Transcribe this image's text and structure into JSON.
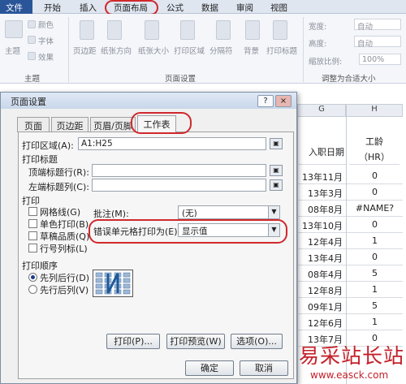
{
  "ribbon": {
    "tabs": [
      "文件",
      "开始",
      "插入",
      "页面布局",
      "公式",
      "数据",
      "审阅",
      "视图"
    ],
    "theme_group": {
      "label": "主题",
      "theme_button": "主题",
      "colors": "颜色",
      "fonts": "字体",
      "effects": "效果"
    },
    "page_setup_group": {
      "label": "页面设置",
      "buttons": [
        "页边距",
        "纸张方向",
        "纸张大小",
        "打印区域",
        "分隔符",
        "背景",
        "打印标题"
      ]
    },
    "scale_group": {
      "label": "调整为合适大小",
      "width_label": "宽度:",
      "width_value": "自动",
      "height_label": "高度:",
      "height_value": "自动",
      "scale_label": "缩放比例:",
      "scale_value": "100%"
    }
  },
  "sheet": {
    "col_g": "G",
    "col_h": "H",
    "header_g": "入职日期",
    "header_h_line1": "工龄",
    "header_h_line2": "（HR）",
    "rows": [
      {
        "g": "13年11月",
        "h": "0"
      },
      {
        "g": "13年3月",
        "h": "0"
      },
      {
        "g": "08年8月",
        "h": "#NAME?"
      },
      {
        "g": "13年10月",
        "h": "0"
      },
      {
        "g": "12年4月",
        "h": "1"
      },
      {
        "g": "13年4月",
        "h": "0"
      },
      {
        "g": "08年4月",
        "h": "5"
      },
      {
        "g": "12年8月",
        "h": "1"
      },
      {
        "g": "09年1月",
        "h": "5"
      },
      {
        "g": "12年6月",
        "h": "1"
      },
      {
        "g": "13年7月",
        "h": "0"
      }
    ],
    "watermark": "易采站长站",
    "watermark_url": "www.easck.com"
  },
  "dialog": {
    "title": "页面设置",
    "help": "?",
    "close": "×",
    "tabs": [
      "页面",
      "页边距",
      "页眉/页脚",
      "工作表"
    ],
    "print_area_label": "打印区域(A):",
    "print_area_value": "A1:H25",
    "print_titles_label": "打印标题",
    "top_rows_label": "顶端标题行(R):",
    "left_cols_label": "左端标题列(C):",
    "print_label": "打印",
    "gridlines": "网格线(G)",
    "mono": "单色打印(B)",
    "draft": "草稿品质(Q)",
    "row_col_headers": "行号列标(L)",
    "comments_label": "批注(M):",
    "comments_value": "(无)",
    "errors_label": "错误单元格打印为(E):",
    "errors_value": "显示值",
    "order_label": "打印顺序",
    "down_then_over": "先列后行(D)",
    "over_then_down": "先行后列(V)",
    "print_btn": "打印(P)...",
    "preview_btn": "打印预览(W)",
    "options_btn": "选项(O)...",
    "ok_btn": "确定",
    "cancel_btn": "取消"
  }
}
